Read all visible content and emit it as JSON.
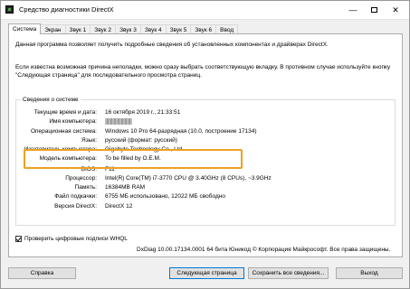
{
  "window": {
    "title": "Средство диагностики DirectX",
    "minimize_glyph": "—",
    "close_glyph": "✕"
  },
  "tabs": [
    {
      "label": "Система"
    },
    {
      "label": "Экран"
    },
    {
      "label": "Звук 1"
    },
    {
      "label": "Звук 2"
    },
    {
      "label": "Звук 3"
    },
    {
      "label": "Звук 4"
    },
    {
      "label": "Звук 5"
    },
    {
      "label": "Звук 6"
    },
    {
      "label": "Ввод"
    }
  ],
  "intro": {
    "line1": "Данная программа позволяет получить подробные сведения об установленных компонентах и драйверах DirectX.",
    "line2": "Если известна возможная причина неполадки, можно сразу выбрать соответствующую вкладку. В противном случае используйте кнопку \"Следующая страница\" для последовательного просмотра страниц."
  },
  "system_info": {
    "title": "Сведения о системе",
    "rows": [
      {
        "label": "Текущие время и дата:",
        "value": "16 октября 2019 г., 21:33:51"
      },
      {
        "label": "Имя компьютера:",
        "value": ""
      },
      {
        "label": "Операционная система:",
        "value": "Windows 10 Pro 64-разрядная (10.0, построение 17134)"
      },
      {
        "label": "Язык:",
        "value": "русский (формат: русский)"
      },
      {
        "label": "Изготовитель компьютера:",
        "value": "Gigabyte Technology Co., Ltd."
      },
      {
        "label": "Модель компьютера:",
        "value": "To be filled by O.E.M."
      },
      {
        "label": "BIOS:",
        "value": "F11"
      },
      {
        "label": "Процессор:",
        "value": "Intel(R) Core(TM) i7-3770 CPU @ 3.40GHz (8 CPUs), ~3.9GHz"
      },
      {
        "label": "Память:",
        "value": "16384MB RAM"
      },
      {
        "label": "Файл подкачки:",
        "value": "6755 МБ использовано, 12022 МБ свободно"
      },
      {
        "label": "Версия DirectX:",
        "value": "DirectX 12"
      }
    ]
  },
  "whql_checkbox": {
    "label": "Проверить цифровые подписи WHQL",
    "checked": true
  },
  "footer": "DxDiag 10.00.17134.0001 64 бита Юникод  © Корпорация Майкрософт. Все права защищены.",
  "buttons": {
    "help": "Справка",
    "next": "Следующая страница",
    "save": "Сохранить все сведения...",
    "exit": "Выход"
  },
  "colors": {
    "highlight": "#f0a020",
    "default_button_border": "#0078d7"
  }
}
